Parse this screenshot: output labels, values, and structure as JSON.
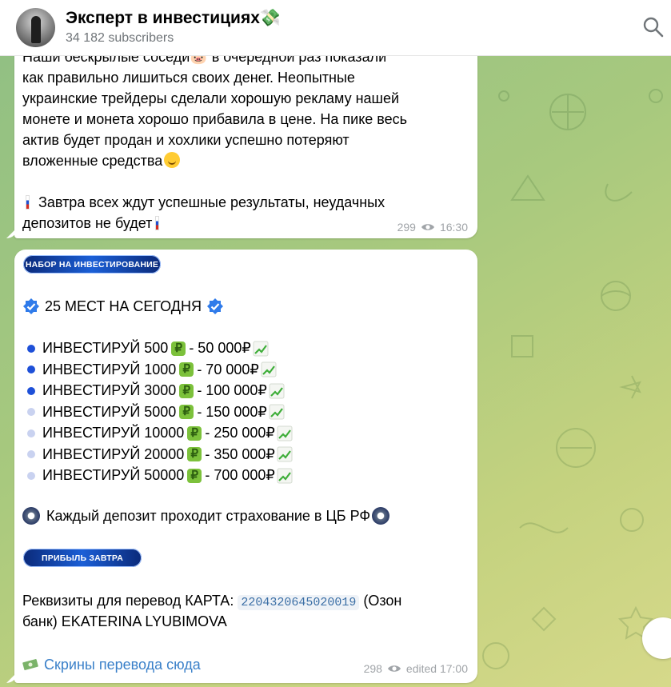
{
  "header": {
    "title": "Эксперт в инвестициях💸",
    "subscribers": "34 182 subscribers"
  },
  "post1": {
    "line1": "Наши бескрылые соседи🐷 в очередной раз показали",
    "line2": "как правильно лишиться своих денег. Неопытные",
    "line3": "украинские трейдеры сделали хорошую рекламу нашей",
    "line4": "монете и монета хорошо прибавила в цене. На пике весь",
    "line5": "актив будет продан и хохлики успешно потеряют",
    "line6": "вложенные средства",
    "line7": "Завтра всех ждут успешные результаты, неудачных",
    "line8": "депозитов не будет",
    "views": "299",
    "time": "16:30"
  },
  "post2": {
    "banner1": "НАБОР НА ИНВЕСТИРОВАНИЕ",
    "headline": "25 МЕСТ НА СЕГОДНЯ",
    "tiers": [
      {
        "left": "ИНВЕСТИРУЙ 500",
        "right": " -  50 000₽"
      },
      {
        "left": "ИНВЕСТИРУЙ 1000",
        "right": " - 70 000₽"
      },
      {
        "left": "ИНВЕСТИРУЙ 3000",
        "right": " - 100 000₽"
      },
      {
        "left": "ИНВЕСТИРУЙ 5000",
        "right": " - 150 000₽"
      },
      {
        "left": "ИНВЕСТИРУЙ 10000",
        "right": " - 250 000₽"
      },
      {
        "left": "ИНВЕСТИРУЙ 20000",
        "right": " - 350 000₽"
      },
      {
        "left": "ИНВЕСТИРУЙ 50000",
        "right": " - 700 000₽"
      }
    ],
    "insurance": "Каждый депозит проходит страхование в ЦБ РФ",
    "banner2": "ПРИБЫЛЬ ЗАВТРА",
    "requisites_prefix": "Реквизиты для перевод КАРТА:",
    "card_number": "2204320645020019",
    "requisites_suffix": " (Озон",
    "requisites_line2": "банк) EKATERINA LYUBIMOVA",
    "screens_link": "Скрины перевода сюда",
    "views": "298",
    "time": "edited 17:00"
  },
  "colors": {
    "accent": "#3a80c9",
    "dot_blue": "#1e50d8",
    "dot_light": "#c9d2f0",
    "rub_green": "#7cc13b"
  },
  "icons": {
    "search": "search-icon",
    "eye": "eye-icon",
    "verified": "verified-icon",
    "chart": "chart-up-icon",
    "rub": "rub-coin-icon",
    "seal": "cb-seal-icon"
  }
}
